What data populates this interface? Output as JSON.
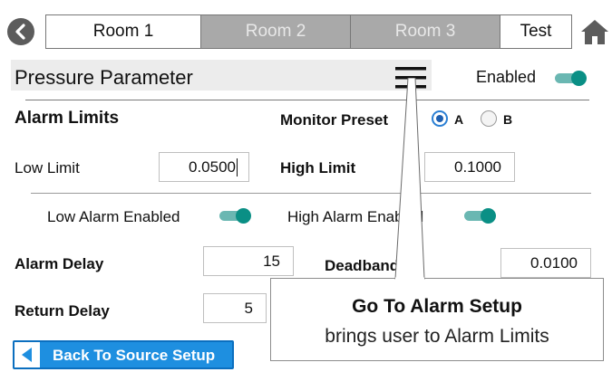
{
  "nav": {
    "tabs": [
      {
        "label": "Room 1",
        "state": "active"
      },
      {
        "label": "Room 2",
        "state": "inactive"
      },
      {
        "label": "Room 3",
        "state": "inactive"
      },
      {
        "label": "Test",
        "state": "active"
      }
    ],
    "back_icon": "chevron-left-icon",
    "home_icon": "home-icon"
  },
  "header": {
    "title": "Pressure Parameter",
    "menu_icon": "hamburger-menu-icon",
    "enabled_label": "Enabled",
    "enabled": true
  },
  "alarm_limits": {
    "title": "Alarm Limits",
    "monitor_preset_label": "Monitor Preset",
    "preset_options": [
      {
        "label": "A",
        "selected": true
      },
      {
        "label": "B",
        "selected": false
      }
    ],
    "low_limit_label": "Low Limit",
    "low_limit_value": "0.0500",
    "high_limit_label": "High Limit",
    "high_limit_value": "0.1000"
  },
  "toggles": {
    "low_alarm_label": "Low Alarm Enabled",
    "low_alarm_enabled": true,
    "high_alarm_label": "High Alarm Enabled",
    "high_alarm_enabled": true
  },
  "delays": {
    "alarm_delay_label": "Alarm Delay",
    "alarm_delay_value": "15",
    "return_delay_label": "Return Delay",
    "return_delay_value": "5",
    "deadband_label": "Deadband",
    "deadband_value": "0.0100"
  },
  "source_button": {
    "label": "Back To Source Setup"
  },
  "callout": {
    "title": "Go To Alarm Setup",
    "subtitle": "brings user to Alarm Limits"
  },
  "colors": {
    "accent_blue": "#1e8fe0",
    "toggle_teal": "#0a8f85",
    "tab_inactive": "#a9a9a9"
  }
}
